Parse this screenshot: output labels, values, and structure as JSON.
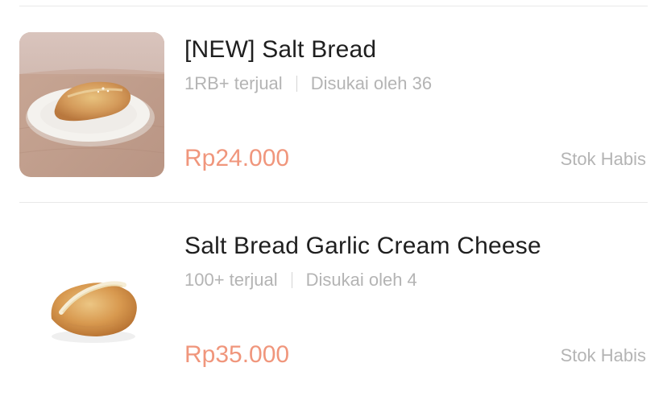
{
  "products": [
    {
      "name": "[NEW] Salt Bread",
      "sold": "1RB+ terjual",
      "likes": "Disukai oleh 36",
      "price": "Rp24.000",
      "status": "Stok Habis",
      "image_icon": "salt-bread-on-plate-photo"
    },
    {
      "name": "Salt Bread Garlic Cream Cheese",
      "sold": "100+ terjual",
      "likes": "Disukai oleh 4",
      "price": "Rp35.000",
      "status": "Stok Habis",
      "image_icon": "salt-bread-garlic-cream-cheese-photo"
    }
  ],
  "colors": {
    "price": "#f0967c",
    "muted_text": "#b4b4b4",
    "title_text": "#1f1f1f",
    "divider": "#e9e9e9"
  }
}
